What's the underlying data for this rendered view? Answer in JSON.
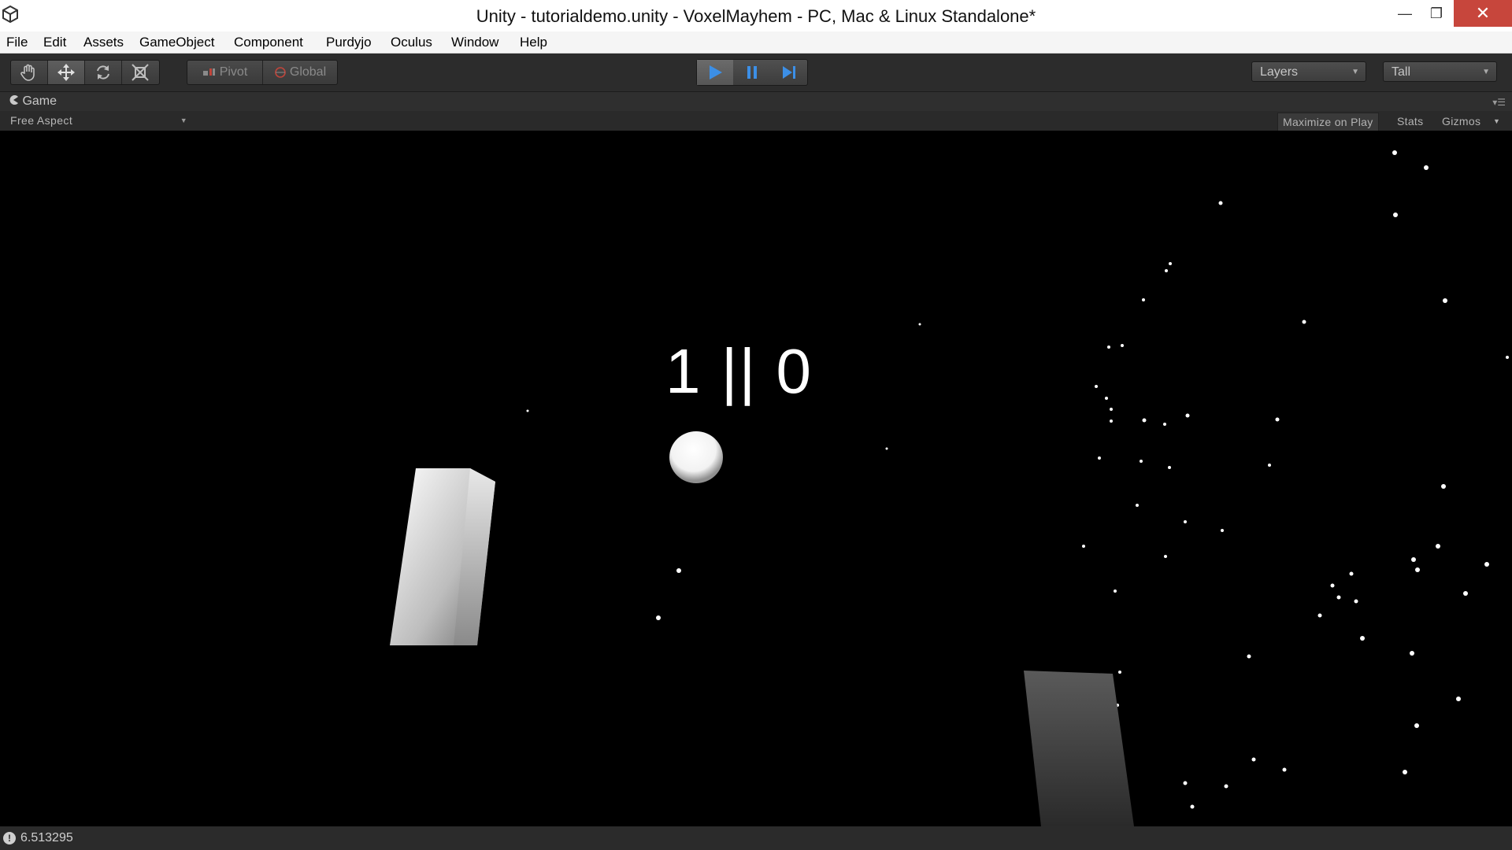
{
  "window": {
    "title": "Unity - tutorialdemo.unity - VoxelMayhem - PC, Mac & Linux Standalone*",
    "minimize_glyph": "—",
    "restore_glyph": "❐",
    "close_glyph": "✕"
  },
  "menu": [
    "File",
    "Edit",
    "Assets",
    "GameObject",
    "Component",
    "Purdyjo",
    "Oculus",
    "Window",
    "Help"
  ],
  "toolbar": {
    "tools": [
      "hand-tool",
      "move-tool",
      "rotate-tool",
      "scale-tool"
    ],
    "active_tool": "move-tool",
    "pivot_label": "Pivot",
    "global_label": "Global",
    "play_active": true,
    "layers_label": "Layers",
    "layout_label": "Tall",
    "accent_color": "#3c8fe6"
  },
  "panel": {
    "tab_label": "Game",
    "aspect_label": "Free Aspect",
    "maximize_label": "Maximize on Play",
    "stats_label": "Stats",
    "gizmos_label": "Gizmos"
  },
  "game": {
    "score_text": "1 || 0"
  },
  "status": {
    "message": "6.513295"
  }
}
